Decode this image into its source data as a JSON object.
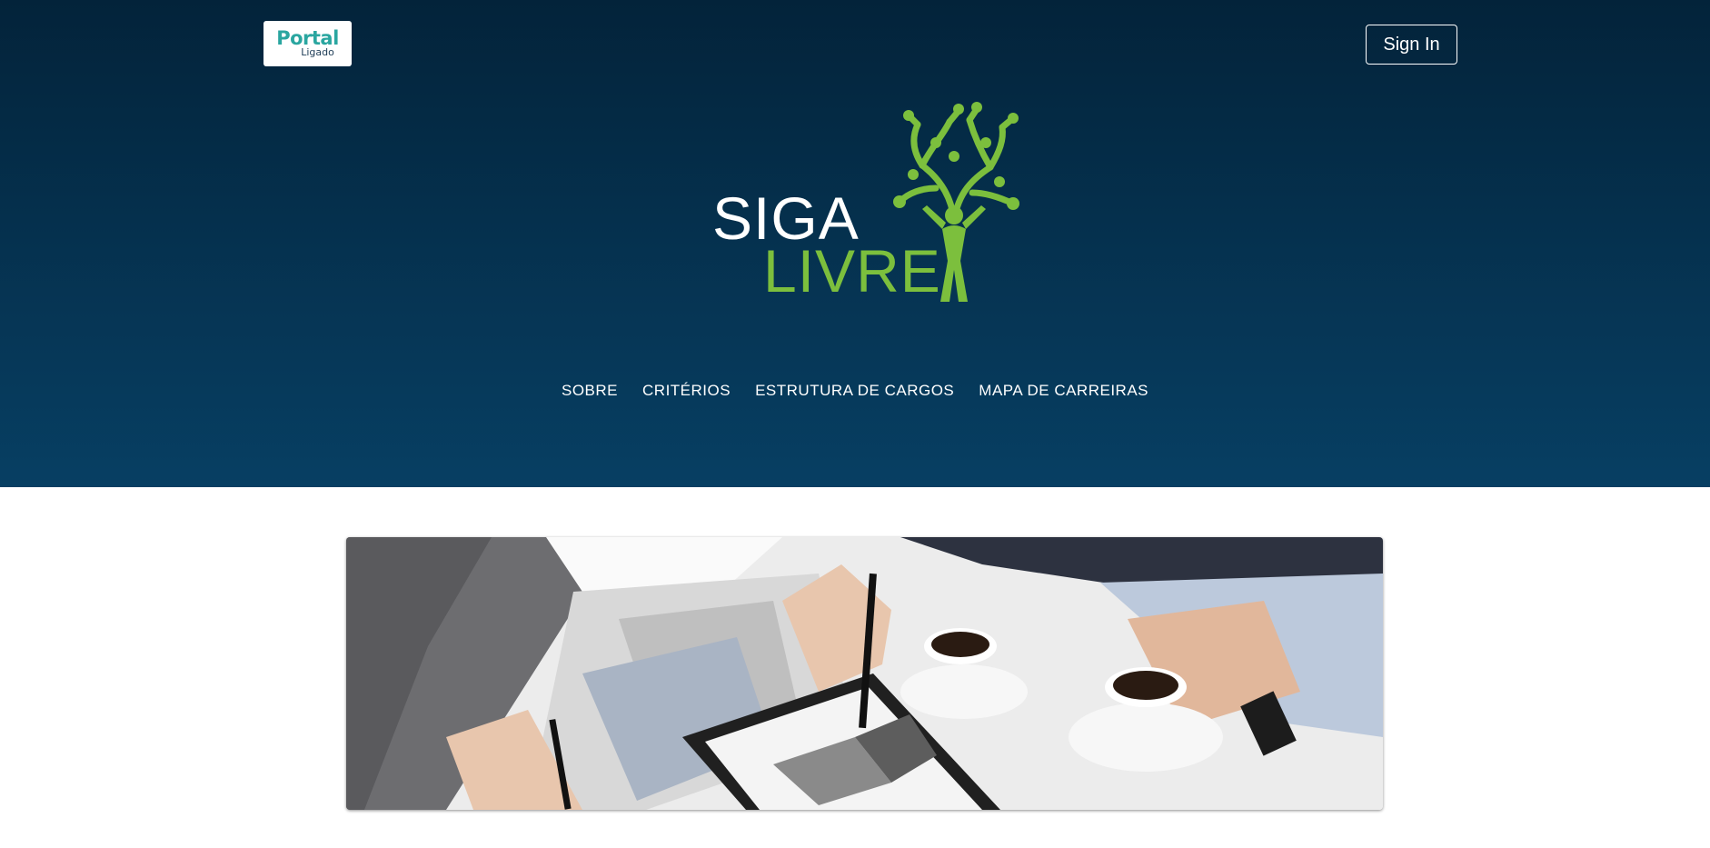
{
  "header": {
    "logo_word": "Portal",
    "logo_sub": "Ligado",
    "sign_in_label": "Sign In"
  },
  "brand": {
    "line1": "SIGA",
    "line2": "LIVRE",
    "colors": {
      "primary_text": "#ffffff",
      "accent_green": "#7cbf3d"
    }
  },
  "nav": {
    "items": [
      {
        "label": "SOBRE"
      },
      {
        "label": "CRITÉRIOS"
      },
      {
        "label": "ESTRUTURA DE CARGOS"
      },
      {
        "label": "MAPA DE CARREIRAS"
      }
    ]
  },
  "hero": {
    "colors": {
      "top": "#03233a",
      "bottom": "#073f63"
    }
  },
  "banner": {
    "image": "business-meeting-charts-photo"
  }
}
